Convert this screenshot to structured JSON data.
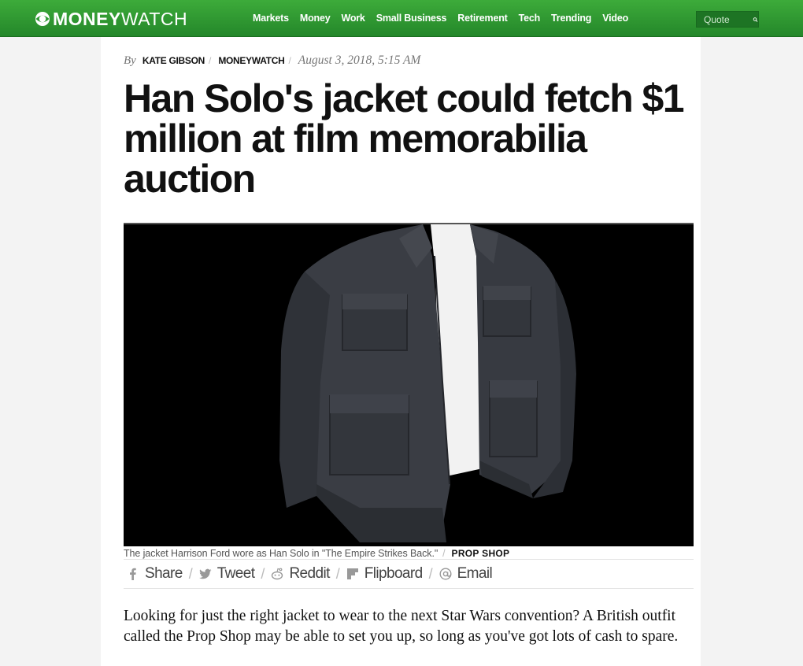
{
  "brand": {
    "logo_bold": "MONEY",
    "logo_light": "WATCH"
  },
  "nav": {
    "items": [
      "Markets",
      "Money",
      "Work",
      "Small Business",
      "Retirement",
      "Tech",
      "Trending",
      "Video"
    ],
    "quote_placeholder": "Quote"
  },
  "article": {
    "byline_prefix": "By",
    "author": "KATE GIBSON",
    "source": "MONEYWATCH",
    "date": "August 3, 2018, 5:15 AM",
    "headline": "Han Solo's jacket could fetch $1 million at film memorabilia auction",
    "caption": "The jacket Harrison Ford wore as Han Solo in \"The Empire Strikes Back.\"",
    "photo_credit": "PROP SHOP",
    "lede": "Looking for just the right jacket to wear to the next Star Wars convention? A British outfit called the Prop Shop may be able to set you up, so long as you've got lots of cash to spare."
  },
  "share": {
    "share": "Share",
    "tweet": "Tweet",
    "reddit": "Reddit",
    "flipboard": "Flipboard",
    "email": "Email"
  },
  "colors": {
    "nav_green": "#2e9b33",
    "quote_box": "#1d7424"
  }
}
